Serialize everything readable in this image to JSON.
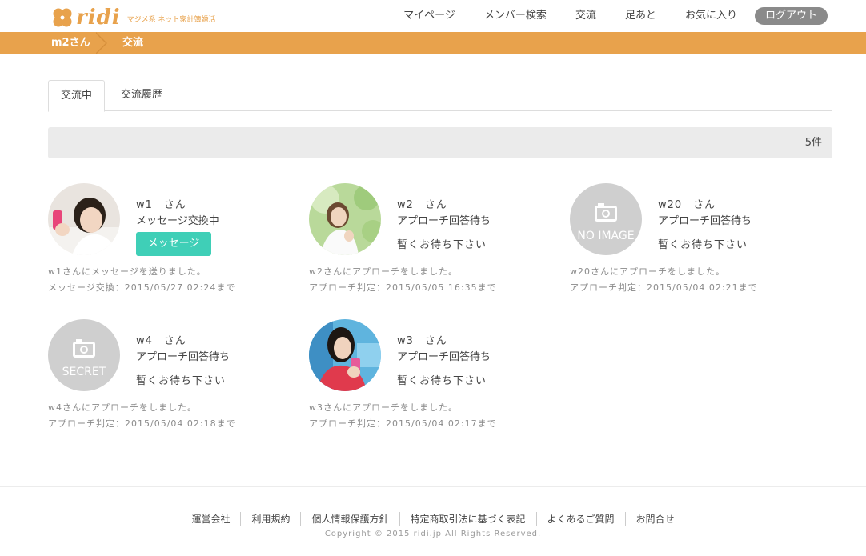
{
  "brand": {
    "logo_text": "ridi",
    "tagline": "マジメ系 ネット家計簿婚活",
    "color": "#e8a24c"
  },
  "nav": {
    "items": [
      "マイページ",
      "メンバー検索",
      "交流",
      "足あと",
      "お気に入り"
    ],
    "logout": "ログアウト"
  },
  "breadcrumb": {
    "user": "m2さん",
    "current": "交流"
  },
  "tabs": {
    "active": "交流中",
    "history": "交流履歴"
  },
  "count": "5件",
  "members": [
    {
      "name": "w1　さん",
      "status": "メッセージ交換中",
      "button": "メッセージ",
      "note1": "w1さんにメッセージを送りました。",
      "note2": "メッセージ交換：2015/05/27 02:24まで",
      "avatar": "photo-woman-phone"
    },
    {
      "name": "w2　さん",
      "status": "アプローチ回答待ち",
      "wait": "暫くお待ち下さい",
      "note1": "w2さんにアプローチをしました。",
      "note2": "アプローチ判定：2015/05/05 16:35まで",
      "avatar": "photo-woman-outdoor"
    },
    {
      "name": "w20　さん",
      "status": "アプローチ回答待ち",
      "wait": "暫くお待ち下さい",
      "note1": "w20さんにアプローチをしました。",
      "note2": "アプローチ判定：2015/05/04 02:21まで",
      "placeholder": "NO IMAGE"
    },
    {
      "name": "w4　さん",
      "status": "アプローチ回答待ち",
      "wait": "暫くお待ち下さい",
      "note1": "w4さんにアプローチをしました。",
      "note2": "アプローチ判定：2015/05/04 02:18まで",
      "placeholder": "SECRET"
    },
    {
      "name": "w3　さん",
      "status": "アプローチ回答待ち",
      "wait": "暫くお待ち下さい",
      "note1": "w3さんにアプローチをしました。",
      "note2": "アプローチ判定：2015/05/04 02:17まで",
      "avatar": "photo-woman-drink"
    }
  ],
  "colors": {
    "accent": "#e8a24c",
    "message_button": "#3fcfb7",
    "logout_button": "#8a8a8a"
  },
  "footer": {
    "links": [
      "運営会社",
      "利用規約",
      "個人情報保護方針",
      "特定商取引法に基づく表記",
      "よくあるご質問",
      "お問合せ"
    ],
    "copyright": "Copyright © 2015 ridi.jp All Rights Reserved."
  }
}
